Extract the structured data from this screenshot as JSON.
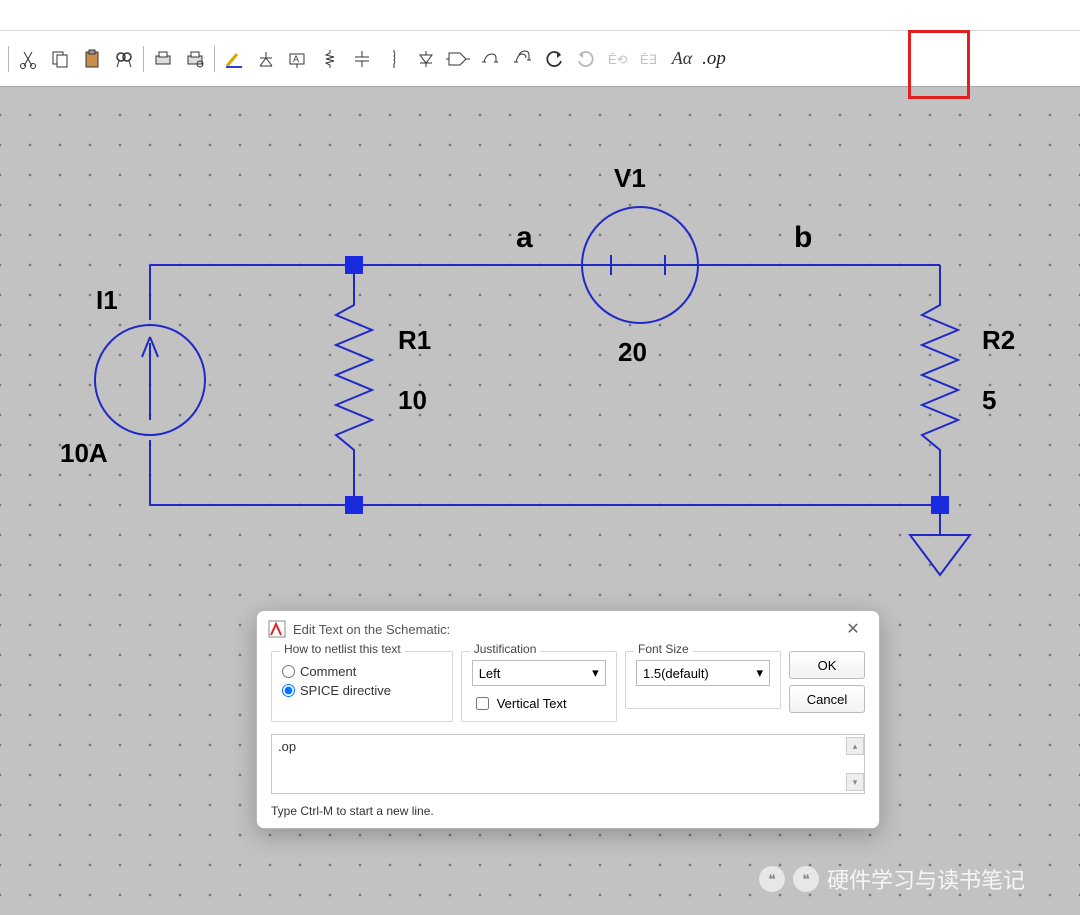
{
  "toolbar": {
    "buttons": [
      "cut-icon",
      "copy-icon",
      "paste-icon",
      "find-icon",
      "sep",
      "print-icon",
      "print-setup-icon",
      "sep",
      "draw-wire-icon",
      "ground-icon",
      "label-net-icon",
      "resistor-icon",
      "capacitor-icon",
      "inductor-icon",
      "diode-icon",
      "component-icon",
      "move-icon",
      "drag-icon",
      "undo-icon",
      "redo-icon",
      "rotate-icon",
      "mirror-icon",
      "text-icon",
      "spice-dir-icon"
    ],
    "spice_dir_label": ".op"
  },
  "schematic": {
    "components": {
      "I1": {
        "name": "I1",
        "value": "10A"
      },
      "V1": {
        "name": "V1",
        "value": "20"
      },
      "R1": {
        "name": "R1",
        "value": "10"
      },
      "R2": {
        "name": "R2",
        "value": "5"
      }
    },
    "nets": {
      "a": "a",
      "b": "b"
    }
  },
  "dialog": {
    "title": "Edit Text on the Schematic:",
    "group_netlist": "How to netlist this text",
    "radio_comment": "Comment",
    "radio_directive": "SPICE directive",
    "group_just": "Justification",
    "just_value": "Left",
    "vertical_text": "Vertical Text",
    "group_font": "Font Size",
    "font_value": "1.5(default)",
    "ok": "OK",
    "cancel": "Cancel",
    "text_value": ".op",
    "hint": "Type Ctrl-M to start a new line."
  },
  "watermark": "硬件学习与读书笔记"
}
